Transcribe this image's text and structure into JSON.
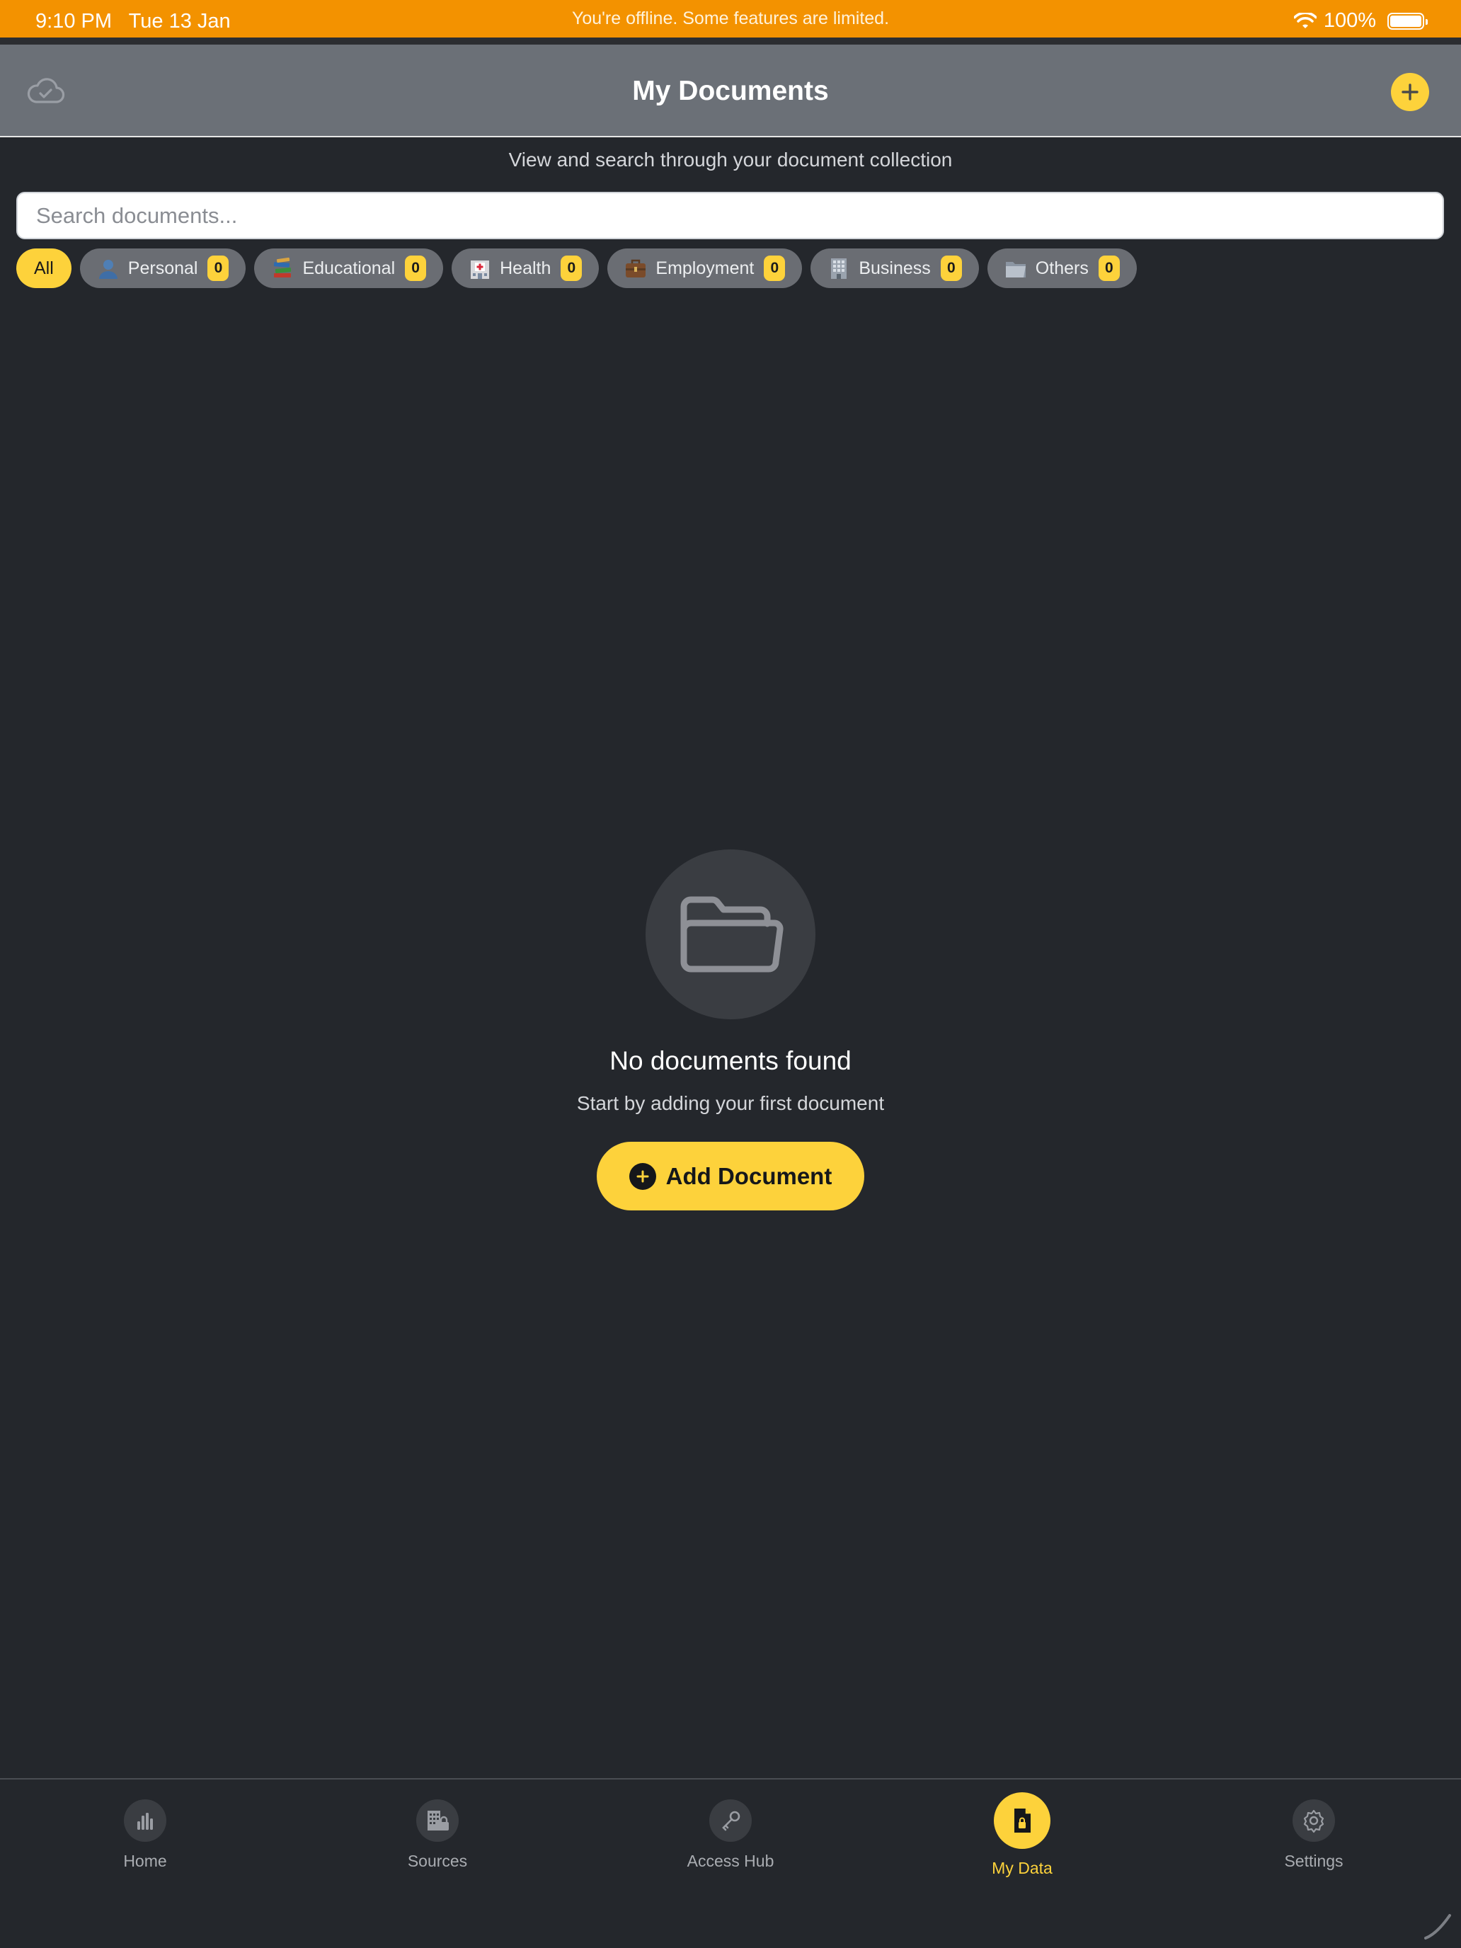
{
  "status_bar": {
    "time": "9:10 PM",
    "date": "Tue 13 Jan",
    "offline_message": "You're offline. Some features are limited.",
    "battery": "100%",
    "icons": [
      "wifi-icon",
      "battery-icon"
    ]
  },
  "header": {
    "title": "My Documents",
    "left_icon": "cloud-check-icon",
    "right_icon": "plus-icon"
  },
  "subtitle": "View and search through your document collection",
  "search": {
    "placeholder": "Search documents...",
    "value": ""
  },
  "filters": [
    {
      "label": "All",
      "active": true
    },
    {
      "label": "Personal",
      "count": "0",
      "icon": "person-icon"
    },
    {
      "label": "Educational",
      "count": "0",
      "icon": "books-icon"
    },
    {
      "label": "Health",
      "count": "0",
      "icon": "hospital-icon"
    },
    {
      "label": "Employment",
      "count": "0",
      "icon": "briefcase-icon"
    },
    {
      "label": "Business",
      "count": "0",
      "icon": "office-building-icon"
    },
    {
      "label": "Others",
      "count": "0",
      "icon": "folder-icon"
    }
  ],
  "empty_state": {
    "icon": "folder-open-icon",
    "title": "No documents found",
    "message": "Start by adding your first document",
    "button_label": "Add Document"
  },
  "tabs": [
    {
      "label": "Home",
      "icon": "bar-chart-icon"
    },
    {
      "label": "Sources",
      "icon": "building-lock-icon"
    },
    {
      "label": "Access Hub",
      "icon": "key-icon"
    },
    {
      "label": "My Data",
      "icon": "document-lock-icon",
      "active": true
    },
    {
      "label": "Settings",
      "icon": "gear-icon"
    }
  ],
  "colors": {
    "accent": "#fdd23b",
    "offline_banner": "#f39200",
    "background": "#24272c",
    "header": "#6b7077"
  }
}
